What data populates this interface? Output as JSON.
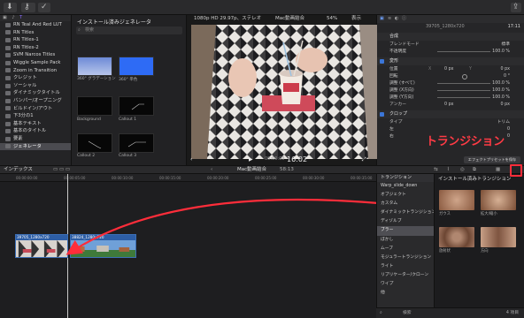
{
  "library": {
    "items": [
      {
        "label": "RN Teal And Red LUT",
        "selected": false
      },
      {
        "label": "RN Titles",
        "selected": false
      },
      {
        "label": "RN Titles-1",
        "selected": false
      },
      {
        "label": "RN Titles-2",
        "selected": false
      },
      {
        "label": "SVM Narcos Titles",
        "selected": false
      },
      {
        "label": "Wiggle Sample Pack",
        "selected": false
      },
      {
        "label": "Zoom in Transition",
        "selected": false
      },
      {
        "label": "クレジット",
        "selected": false
      },
      {
        "label": "ソーシャル",
        "selected": false
      },
      {
        "label": "ダイナミックタイトル",
        "selected": false
      },
      {
        "label": "バンパー/オープニング",
        "selected": false
      },
      {
        "label": "ビルドイン/アウト",
        "selected": false
      },
      {
        "label": "下3分の1",
        "selected": false
      },
      {
        "label": "基本テキスト",
        "selected": false
      },
      {
        "label": "基本のタイトル",
        "selected": false
      },
      {
        "label": "要素",
        "selected": false
      },
      {
        "label": "ジェネレータ",
        "selected": true
      }
    ]
  },
  "browser": {
    "title": "インストール済みジェネレータ",
    "search_placeholder": "検索",
    "thumbs": [
      {
        "label": "360° グラデーション"
      },
      {
        "label": "360° 単色"
      },
      {
        "label": "Background"
      },
      {
        "label": "Callout 1"
      },
      {
        "label": "Callout 2"
      },
      {
        "label": "Callout 3"
      }
    ]
  },
  "viewer": {
    "format": "1080p HD 29.97p、ステレオ",
    "project": "Mac動画結合",
    "zoom": "54%",
    "view": "表示",
    "timecode": "16:02"
  },
  "inspector": {
    "clip_name": "39705_1280x720",
    "duration": "17:11",
    "section_compositing": "合成",
    "blend_mode_label": "ブレンドモード",
    "blend_mode_value": "標準",
    "opacity_label": "不透明度",
    "opacity_value": "100.0 %",
    "section_transform": "変形",
    "position_label": "位置",
    "position_x": "0 px",
    "position_y": "0 px",
    "rotation_label": "回転",
    "rotation_value": "0 °",
    "scale_all_label": "調整 (すべて)",
    "scale_all_value": "100.0 %",
    "scale_x_label": "調整 (X方向)",
    "scale_x_value": "100.0 %",
    "scale_y_label": "調整 (Y方向)",
    "scale_y_value": "100.0 %",
    "anchor_label": "アンカー",
    "anchor_x": "0 px",
    "anchor_y": "0 px",
    "section_crop": "クロップ",
    "type_label": "タイプ",
    "type_value": "トリム",
    "left_label": "左",
    "left_value": "0",
    "right_label": "右",
    "right_value": "0",
    "effects_button": "エフェクトプリセットを保存"
  },
  "timeline_bar": {
    "index_label": "インデックス",
    "project_label": "Mac動画結合",
    "duration": "58:13"
  },
  "timeline": {
    "ruler": [
      "00:00:00:00",
      "00:00:05:00",
      "00:00:10:00",
      "00:00:15:00",
      "00:00:20:00",
      "00:00:25:00",
      "00:00:30:00",
      "00:00:35:00"
    ],
    "clip1_label": "39705_1280x720",
    "clip2_label": "38824_1280x720"
  },
  "transitions": {
    "header": "トランジション",
    "items": [
      {
        "label": "Warp_slide_down",
        "selected": false
      },
      {
        "label": "オブジェクト",
        "selected": false
      },
      {
        "label": "カスタム",
        "selected": false
      },
      {
        "label": "ダイナミックトランジション",
        "selected": false
      },
      {
        "label": "ディゾルブ",
        "selected": false
      },
      {
        "label": "ブラー",
        "selected": true
      },
      {
        "label": "ぼかし",
        "selected": false
      },
      {
        "label": "ムーブ",
        "selected": false
      },
      {
        "label": "モジュラートランジション",
        "selected": false
      },
      {
        "label": "ライト",
        "selected": false
      },
      {
        "label": "リプリケーター/クローン",
        "selected": false
      },
      {
        "label": "ワイプ",
        "selected": false
      },
      {
        "label": "他",
        "selected": false
      }
    ]
  },
  "transition_browser": {
    "title": "インストール済みトランジション",
    "items": [
      {
        "label": "ガウス"
      },
      {
        "label": "拡大/縮小"
      },
      {
        "label": "放射状"
      },
      {
        "label": "方向"
      }
    ],
    "search_placeholder": "検索",
    "count": "4 項目"
  },
  "annotation": {
    "text": "トランジション",
    "color": "#ff3b45"
  },
  "colors": {
    "accent": "#2f5fa8",
    "highlight": "#ff2d3a"
  }
}
